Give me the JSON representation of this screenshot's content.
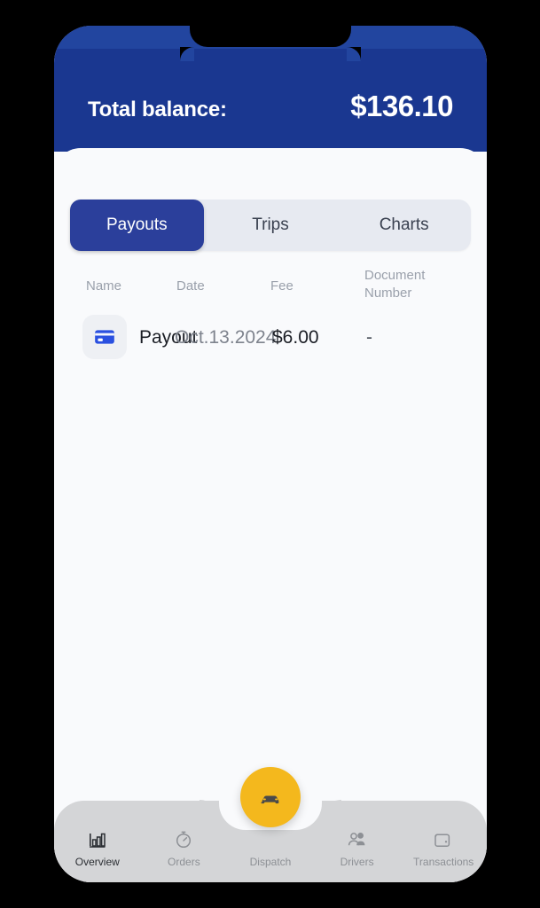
{
  "header": {
    "balance_label": "Total balance:",
    "balance_amount": "$136.10",
    "background_color": "#1a3790"
  },
  "tabs": [
    {
      "label": "Payouts",
      "active": true
    },
    {
      "label": "Trips",
      "active": false
    },
    {
      "label": "Charts",
      "active": false
    }
  ],
  "table": {
    "columns": {
      "name": "Name",
      "date": "Date",
      "fee": "Fee",
      "document_number": "Document Number"
    },
    "rows": [
      {
        "icon": "credit-card-icon",
        "name": "Payout",
        "date": "Oct.13.2024",
        "fee": "$6.00",
        "document_number": "-"
      }
    ]
  },
  "bottom_nav": {
    "items": [
      {
        "label": "Overview",
        "icon": "bar-chart-icon",
        "active": true
      },
      {
        "label": "Orders",
        "icon": "stopwatch-icon",
        "active": false
      },
      {
        "label": "Dispatch",
        "icon": "car-icon",
        "active": false
      },
      {
        "label": "Drivers",
        "icon": "people-icon",
        "active": false
      },
      {
        "label": "Transactions",
        "icon": "wallet-icon",
        "active": false
      }
    ],
    "fab": {
      "icon": "car-icon",
      "color": "#f4b81d"
    }
  },
  "colors": {
    "brand_blue": "#1a3790",
    "tab_active": "#2b3f9b",
    "accent_yellow": "#f4b81d",
    "sheet_background": "#f9fafc",
    "nav_background": "#d4d5d7"
  }
}
